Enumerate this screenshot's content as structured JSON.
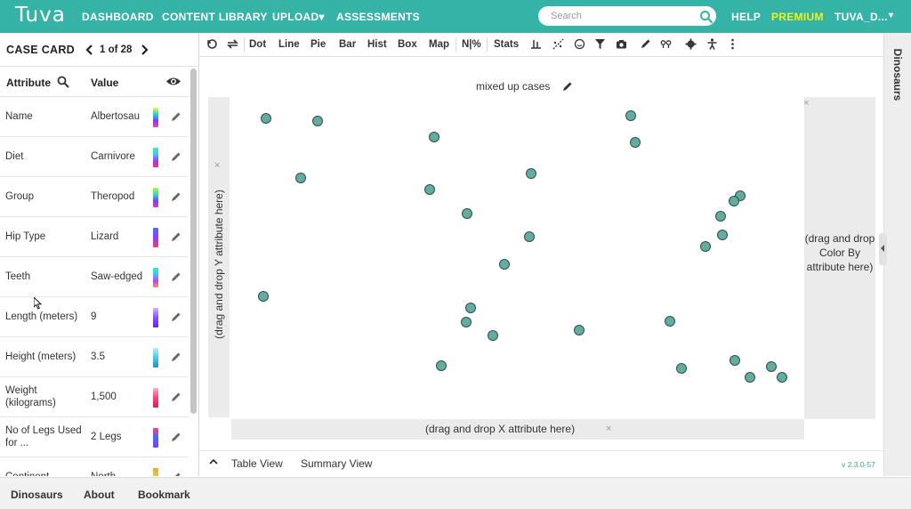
{
  "topbar": {
    "logo": "Tuva",
    "nav": [
      "DASHBOARD",
      "CONTENT LIBRARY",
      "UPLOAD▾",
      "ASSESSMENTS"
    ],
    "search_placeholder": "Search",
    "help": "HELP",
    "premium": "PREMIUM",
    "user": "TUVA_D...",
    "user_caret": "▾",
    "brand_color": "#35b3a7",
    "premium_color": "#e6f51c"
  },
  "case_card": {
    "title": "CASE CARD",
    "position": "1 of 28",
    "col_attribute": "Attribute",
    "col_value": "Value",
    "rows": [
      {
        "attribute": "Name",
        "value": "Albertosau",
        "swatch": [
          "#ffef3b",
          "#1fd7d1",
          "#7c3cff",
          "#ff3ea0"
        ]
      },
      {
        "attribute": "Diet",
        "value": "Carnivore",
        "swatch": [
          "#53e88f",
          "#3dc7ff",
          "#9d3bff",
          "#ff2b6c"
        ]
      },
      {
        "attribute": "Group",
        "value": "Theropod",
        "swatch": [
          "#b5f23a",
          "#36e0b4",
          "#7043ff",
          "#e23ab7"
        ]
      },
      {
        "attribute": "Hip Type",
        "value": "Lizard",
        "swatch": [
          "#4f6dff",
          "#8e3cff",
          "#ff3b5a"
        ]
      },
      {
        "attribute": "Teeth",
        "value": "Saw-edged",
        "swatch": [
          "#2ff0a0",
          "#43c1ff",
          "#b842ff",
          "#ff9a3a"
        ]
      },
      {
        "attribute": "Length (meters)",
        "value": "9",
        "swatch": [
          "#c9b8ff",
          "#8a4dff",
          "#5a2bd6"
        ]
      },
      {
        "attribute": "Height (meters)",
        "value": "3.5",
        "swatch": [
          "#b7f0ff",
          "#4cc7e6",
          "#2a8ec2"
        ]
      },
      {
        "attribute": "Weight (kilograms)",
        "value": "1,500",
        "swatch": [
          "#ffb0c8",
          "#ff3f7a",
          "#d61f55"
        ]
      },
      {
        "attribute": "No of Legs Used for ...",
        "value": "2 Legs",
        "swatch": [
          "#ff3b7a",
          "#3d6dff",
          "#7d3bff"
        ]
      },
      {
        "attribute": "Continent",
        "value": "North",
        "swatch": [
          "#ff9a3a",
          "#b4f03a",
          "#36d9a8"
        ]
      }
    ]
  },
  "toolbar": {
    "buttons": [
      "Dot",
      "Line",
      "Pie",
      "Bar",
      "Hist",
      "Box",
      "Map",
      "N|%",
      "Stats"
    ]
  },
  "graph": {
    "title": "mixed up cases",
    "y_drop_label": "(drag and drop Y attribute here)",
    "x_drop_label": "(drag and drop X attribute here)",
    "color_drop_label": "(drag and drop Color By attribute here)",
    "close_glyph": "×",
    "dot_fill": "#64aca0",
    "dot_stroke": "#2f4f4a",
    "points_value": {
      "x": [
        0.063,
        0.154,
        0.124,
        0.059,
        0.356,
        0.349,
        0.414,
        0.524,
        0.522,
        0.478,
        0.419,
        0.412,
        0.369,
        0.458,
        0.608,
        0.698,
        0.706,
        0.766,
        0.787,
        0.857,
        0.855,
        0.888,
        0.878,
        0.828,
        0.88,
        0.942,
        0.962,
        0.906
      ],
      "y": [
        0.932,
        0.925,
        0.748,
        0.378,
        0.876,
        0.712,
        0.635,
        0.76,
        0.563,
        0.479,
        0.341,
        0.297,
        0.16,
        0.256,
        0.272,
        0.943,
        0.857,
        0.3,
        0.152,
        0.57,
        0.627,
        0.692,
        0.674,
        0.532,
        0.178,
        0.158,
        0.124,
        0.126
      ]
    }
  },
  "graph_footer": {
    "table_view": "Table View",
    "summary_view": "Summary View",
    "version": "v 2.3.0-57"
  },
  "right_panel": {
    "label": "Dinosaurs"
  },
  "bottombar": {
    "items": [
      "Dinosaurs",
      "About",
      "Bookmark"
    ]
  }
}
